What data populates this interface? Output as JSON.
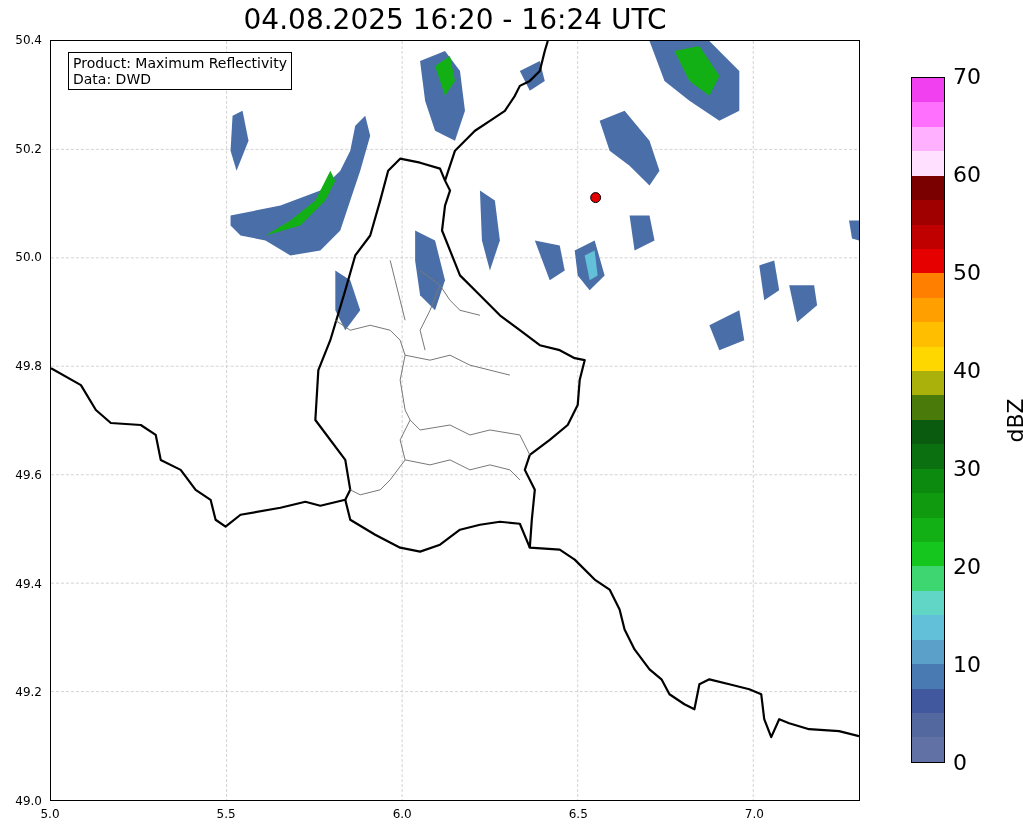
{
  "title": "04.08.2025 16:20 - 16:24 UTC",
  "map": {
    "info_box": [
      "Product: Maximum Reflectivity",
      "Data: DWD"
    ],
    "x_ticks": [
      "5.0",
      "5.5",
      "6.0",
      "6.5",
      "7.0"
    ],
    "y_ticks": [
      "50.4",
      "50.2",
      "50.0",
      "49.8",
      "49.6",
      "49.4",
      "49.2",
      "49.0"
    ]
  },
  "colorbar": {
    "label": "dBZ",
    "ticks": [
      "70",
      "60",
      "50",
      "40",
      "30",
      "20",
      "10",
      "0"
    ],
    "bins": [
      {
        "color": "#f040f0"
      },
      {
        "color": "#ff70ff"
      },
      {
        "color": "#ffb0ff"
      },
      {
        "color": "#ffe0ff"
      },
      {
        "color": "#7a0000"
      },
      {
        "color": "#a00000"
      },
      {
        "color": "#c00000"
      },
      {
        "color": "#e60000"
      },
      {
        "color": "#ff7f00"
      },
      {
        "color": "#ff9f00"
      },
      {
        "color": "#ffbf00"
      },
      {
        "color": "#ffd700"
      },
      {
        "color": "#aab10a"
      },
      {
        "color": "#4a7a0a"
      },
      {
        "color": "#0a5a0f"
      },
      {
        "color": "#0b7010"
      },
      {
        "color": "#0c8a10"
      },
      {
        "color": "#0f9a10"
      },
      {
        "color": "#12b014"
      },
      {
        "color": "#15c61f"
      },
      {
        "color": "#3ed670"
      },
      {
        "color": "#62d6c6"
      },
      {
        "color": "#62c0d8"
      },
      {
        "color": "#5aa0c8"
      },
      {
        "color": "#4a7ab2"
      },
      {
        "color": "#41589e"
      },
      {
        "color": "#5468a0"
      },
      {
        "color": "#6171a5"
      }
    ]
  }
}
